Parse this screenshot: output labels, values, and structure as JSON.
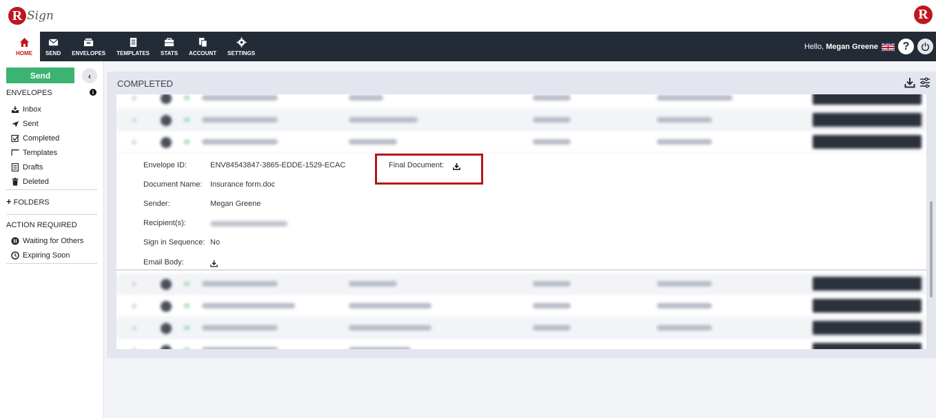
{
  "brand": {
    "logo_letter": "R",
    "logo_text": "Sign"
  },
  "nav": {
    "items": [
      {
        "label": "HOME",
        "icon": "home-icon"
      },
      {
        "label": "SEND",
        "icon": "envelope-icon"
      },
      {
        "label": "ENVELOPES",
        "icon": "inbox-tray-icon"
      },
      {
        "label": "TEMPLATES",
        "icon": "templates-icon"
      },
      {
        "label": "STATS",
        "icon": "briefcase-icon"
      },
      {
        "label": "ACCOUNT",
        "icon": "documents-icon"
      },
      {
        "label": "SETTINGS",
        "icon": "gear-icon"
      }
    ],
    "greeting": "Hello,",
    "user_name": "Megan Greene",
    "help_label": "?"
  },
  "sidebar": {
    "send_label": "Send",
    "envelopes_title": "ENVELOPES",
    "items": [
      {
        "label": "Inbox",
        "icon": "inbox-icon"
      },
      {
        "label": "Sent",
        "icon": "paper-plane-icon"
      },
      {
        "label": "Completed",
        "icon": "checkbox-icon"
      },
      {
        "label": "Templates",
        "icon": "template-icon"
      },
      {
        "label": "Drafts",
        "icon": "drafts-icon"
      },
      {
        "label": "Deleted",
        "icon": "trash-icon"
      }
    ],
    "folders_label": "FOLDERS",
    "action_title": "ACTION REQUIRED",
    "action_items": [
      {
        "label": "Waiting for Others",
        "icon": "pause-icon"
      },
      {
        "label": "Expiring Soon",
        "icon": "clock-icon"
      }
    ]
  },
  "panel": {
    "title": "COMPLETED"
  },
  "detail": {
    "envelope_id_label": "Envelope ID:",
    "envelope_id": "ENV84543847-3865-EDDE-1529-ECAC",
    "final_document_label": "Final Document:",
    "document_name_label": "Document Name:",
    "document_name": "Insurance form.doc",
    "sender_label": "Sender:",
    "sender": "Megan Greene",
    "recipients_label": "Recipient(s):",
    "sequence_label": "Sign in Sequence:",
    "sequence": "No",
    "email_body_label": "Email Body:"
  },
  "colors": {
    "brand_red": "#c0161f",
    "nav_bg": "#232b36",
    "send_green": "#3cb371",
    "highlight_border": "#b3151c"
  }
}
